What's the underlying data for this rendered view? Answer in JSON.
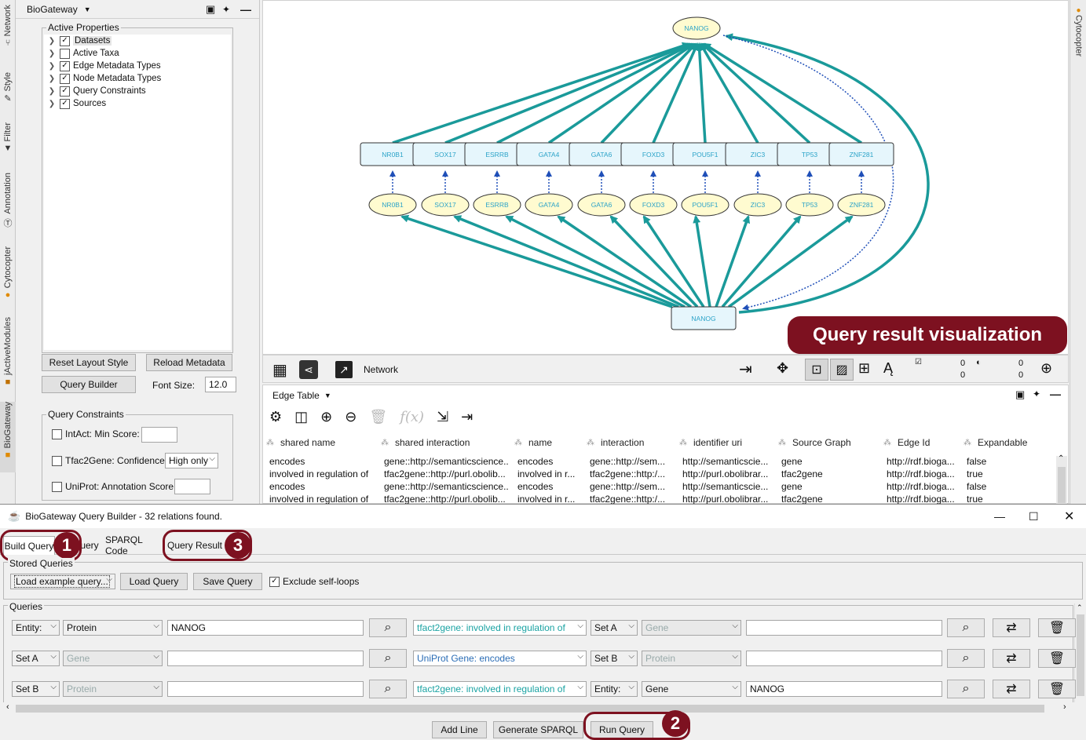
{
  "side_tabs": [
    "Network",
    "Style",
    "Filter",
    "Annotation",
    "Cytocopter",
    "jActiveModules",
    "BioGateway"
  ],
  "right_tab": "Cytocopter",
  "left_panel": {
    "title": "BioGateway",
    "active_properties": {
      "legend": "Active Properties",
      "items": [
        {
          "label": "Datasets",
          "checked": true
        },
        {
          "label": "Active Taxa",
          "checked": false
        },
        {
          "label": "Edge Metadata Types",
          "checked": true
        },
        {
          "label": "Node Metadata Types",
          "checked": true
        },
        {
          "label": "Query Constraints",
          "checked": true
        },
        {
          "label": "Sources",
          "checked": true
        }
      ]
    },
    "reset_layout": "Reset Layout Style",
    "reload_metadata": "Reload Metadata",
    "query_builder": "Query Builder",
    "font_size_label": "Font Size:",
    "font_size": "12.0",
    "constraints": {
      "legend": "Query Constraints",
      "intact": "IntAct: Min Score:",
      "tfac": "Tfac2Gene: Confidence:",
      "tfac_value": "High only",
      "uniprot": "UniProt: Annotation Score:"
    }
  },
  "network": {
    "top_node": "NANOG",
    "bottom_node": "NANOG",
    "boxes": [
      "NR0B1",
      "SOX17",
      "ESRRB",
      "GATA4",
      "GATA6",
      "FOXD3",
      "POU5F1",
      "ZIC3",
      "TP53",
      "ZNF281"
    ],
    "ellipses": [
      "NR0B1",
      "SOX17",
      "ESRRB",
      "GATA4",
      "GATA6",
      "FOXD3",
      "POU5F1",
      "ZIC3",
      "TP53",
      "ZNF281"
    ],
    "edge_color": "#1a9a9a",
    "node_fill": "#fffbd0",
    "box_fill": "#e6f6fc",
    "label_color": "#2ba3c8"
  },
  "callout_viz": "Query result visualization",
  "netbar": {
    "label": "Network",
    "counts": [
      "0",
      "0",
      "0",
      "0"
    ]
  },
  "edge_table": {
    "title": "Edge Table",
    "columns": [
      "shared name",
      "shared interaction",
      "name",
      "interaction",
      "identifier uri",
      "Source Graph",
      "Edge Id",
      "Expandable"
    ],
    "rows": [
      [
        "encodes",
        "gene::http://semanticscience...",
        "encodes",
        "gene::http://sem...",
        "http://semanticscie...",
        "gene",
        "http://rdf.bioga...",
        "false"
      ],
      [
        "involved in regulation of",
        "tfac2gene::http://purl.obolib...",
        "involved in r...",
        "tfac2gene::http:/...",
        "http://purl.obolibrar...",
        "tfac2gene",
        "http://rdf.bioga...",
        "true"
      ],
      [
        "encodes",
        "gene::http://semanticscience...",
        "encodes",
        "gene::http://sem...",
        "http://semanticscie...",
        "gene",
        "http://rdf.bioga...",
        "false"
      ],
      [
        "involved in regulation of",
        "tfac2gene::http://purl.obolib...",
        "involved in r...",
        "tfac2gene::http:/...",
        "http://purl.obolibrar...",
        "tfac2gene",
        "http://rdf.bioga...",
        "true"
      ]
    ]
  },
  "query_builder": {
    "title": "BioGateway Query Builder - 32 relations found.",
    "tabs": [
      "Build Query",
      "uery",
      "SPARQL Code",
      "Query Result"
    ],
    "stored_queries": "Stored Queries",
    "load_example": "Load example query...",
    "load_query": "Load Query",
    "save_query": "Save Query",
    "exclude_self_loops": "Exclude self-loops",
    "queries_legend": "Queries",
    "lines": [
      {
        "a1": "Entity:",
        "a2": "Protein",
        "a3": "NANOG",
        "rel": "tfact2gene: involved in regulation of",
        "b1": "Set A",
        "b2": "Gene",
        "b3": ""
      },
      {
        "a1": "Set A",
        "a2": "Gene",
        "a3": "",
        "rel": "UniProt Gene: encodes",
        "b1": "Set B",
        "b2": "Protein",
        "b3": ""
      },
      {
        "a1": "Set B",
        "a2": "Protein",
        "a3": "",
        "rel": "tfact2gene: involved in regulation of",
        "b1": "Entity:",
        "b2": "Gene",
        "b3": "NANOG"
      }
    ],
    "add_line": "Add Line",
    "generate_sparql": "Generate SPARQL",
    "run_query": "Run Query",
    "markers": [
      "1",
      "2",
      "3"
    ]
  }
}
